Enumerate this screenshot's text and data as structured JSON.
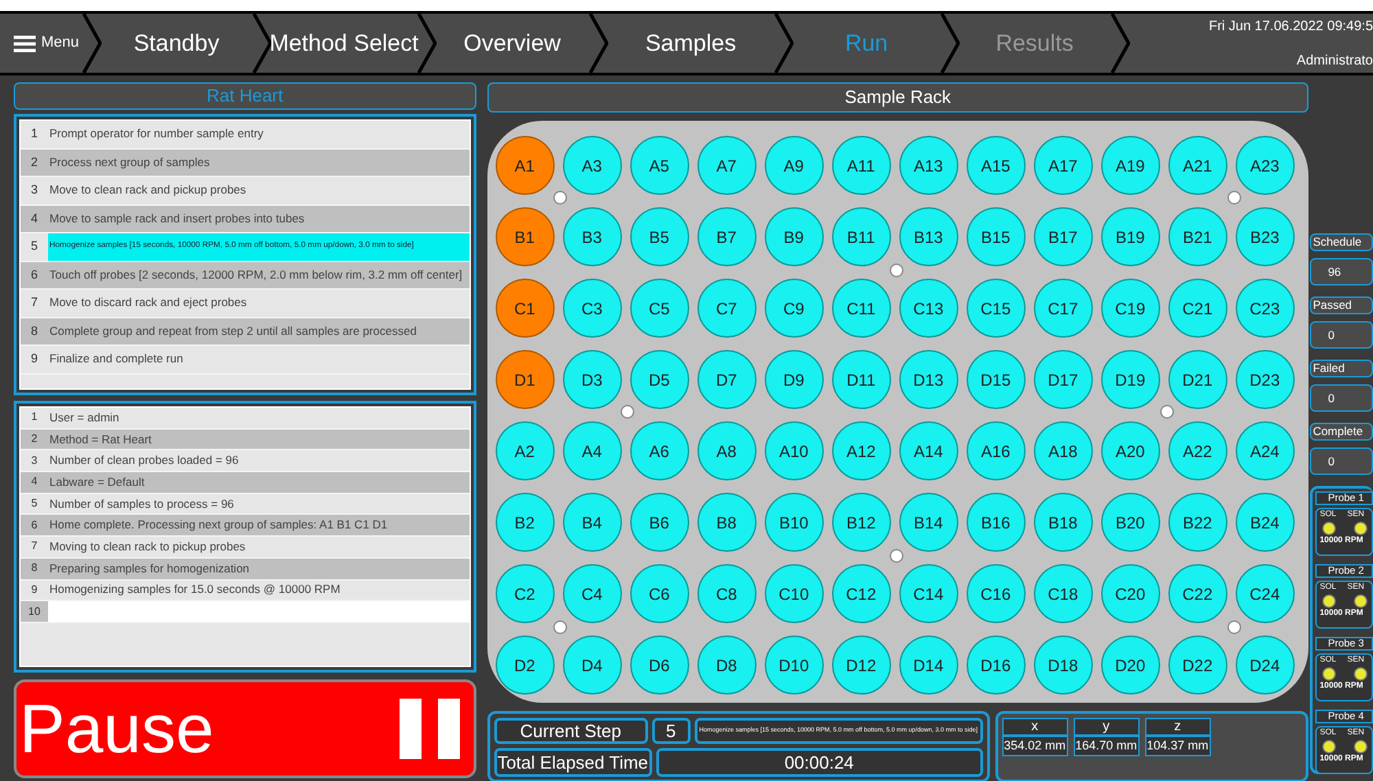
{
  "nav": {
    "menu_label": "Menu",
    "tabs": [
      {
        "label": "Standby",
        "selected": false,
        "disabled": false
      },
      {
        "label": "Method Select",
        "selected": false,
        "disabled": false
      },
      {
        "label": "Overview",
        "selected": false,
        "disabled": false
      },
      {
        "label": "Samples",
        "selected": false,
        "disabled": false
      },
      {
        "label": "Run",
        "selected": true,
        "disabled": false
      },
      {
        "label": "Results",
        "selected": false,
        "disabled": true
      }
    ],
    "datetime": "Fri Jun 17.06.2022 09:49:5",
    "user": "Administrato"
  },
  "method": {
    "title": "Rat Heart",
    "steps": [
      {
        "number": "1",
        "text": "Prompt operator for number sample entry",
        "selected": false
      },
      {
        "number": "2",
        "text": "Process next group of samples",
        "selected": false
      },
      {
        "number": "3",
        "text": "Move to clean rack and pickup probes",
        "selected": false
      },
      {
        "number": "4",
        "text": "Move to sample rack and insert probes into tubes",
        "selected": false
      },
      {
        "number": "5",
        "text": "Homogenize samples [15 seconds, 10000 RPM, 5.0 mm off bottom, 5.0 mm up/down, 3.0 mm to side]",
        "selected": true
      },
      {
        "number": "6",
        "text": "Touch off probes [2 seconds, 12000 RPM, 2.0 mm below rim, 3.2 mm off center]",
        "selected": false
      },
      {
        "number": "7",
        "text": "Move to discard rack and eject probes",
        "selected": false
      },
      {
        "number": "8",
        "text": "Complete group and repeat from step 2 until all samples are processed",
        "selected": false
      },
      {
        "number": "9",
        "text": "Finalize and complete run",
        "selected": false
      }
    ]
  },
  "log": [
    {
      "number": "1",
      "text": "User = admin",
      "current": false
    },
    {
      "number": "2",
      "text": "Method = Rat Heart",
      "current": false
    },
    {
      "number": "3",
      "text": "Number of clean probes loaded = 96",
      "current": false
    },
    {
      "number": "4",
      "text": "Labware = Default",
      "current": false
    },
    {
      "number": "5",
      "text": "Number of samples to process = 96",
      "current": false
    },
    {
      "number": "6",
      "text": "Home complete. Processing next group of samples: A1 B1 C1 D1",
      "current": false
    },
    {
      "number": "7",
      "text": "Moving to clean rack to pickup probes",
      "current": false
    },
    {
      "number": "8",
      "text": "Preparing samples for homogenization",
      "current": false
    },
    {
      "number": "9",
      "text": "Homogenizing samples for 15.0 seconds @ 10000 RPM",
      "current": false
    },
    {
      "number": "10",
      "current": true
    }
  ],
  "pause_button": {
    "label": "Pause"
  },
  "rack": {
    "title": "Sample Rack",
    "rows": [
      [
        {
          "label": "A1",
          "active": true
        },
        {
          "label": "A3",
          "active": false
        },
        {
          "label": "A5",
          "active": false
        },
        {
          "label": "A7",
          "active": false
        },
        {
          "label": "A9",
          "active": false
        },
        {
          "label": "A11",
          "active": false
        },
        {
          "label": "A13",
          "active": false
        },
        {
          "label": "A15",
          "active": false
        },
        {
          "label": "A17",
          "active": false
        },
        {
          "label": "A19",
          "active": false
        },
        {
          "label": "A21",
          "active": false
        },
        {
          "label": "A23",
          "active": false
        }
      ],
      [
        {
          "label": "B1",
          "active": true
        },
        {
          "label": "B3",
          "active": false
        },
        {
          "label": "B5",
          "active": false
        },
        {
          "label": "B7",
          "active": false
        },
        {
          "label": "B9",
          "active": false
        },
        {
          "label": "B11",
          "active": false
        },
        {
          "label": "B13",
          "active": false
        },
        {
          "label": "B15",
          "active": false
        },
        {
          "label": "B17",
          "active": false
        },
        {
          "label": "B19",
          "active": false
        },
        {
          "label": "B21",
          "active": false
        },
        {
          "label": "B23",
          "active": false
        }
      ],
      [
        {
          "label": "C1",
          "active": true
        },
        {
          "label": "C3",
          "active": false
        },
        {
          "label": "C5",
          "active": false
        },
        {
          "label": "C7",
          "active": false
        },
        {
          "label": "C9",
          "active": false
        },
        {
          "label": "C11",
          "active": false
        },
        {
          "label": "C13",
          "active": false
        },
        {
          "label": "C15",
          "active": false
        },
        {
          "label": "C17",
          "active": false
        },
        {
          "label": "C19",
          "active": false
        },
        {
          "label": "C21",
          "active": false
        },
        {
          "label": "C23",
          "active": false
        }
      ],
      [
        {
          "label": "D1",
          "active": true
        },
        {
          "label": "D3",
          "active": false
        },
        {
          "label": "D5",
          "active": false
        },
        {
          "label": "D7",
          "active": false
        },
        {
          "label": "D9",
          "active": false
        },
        {
          "label": "D11",
          "active": false
        },
        {
          "label": "D13",
          "active": false
        },
        {
          "label": "D15",
          "active": false
        },
        {
          "label": "D17",
          "active": false
        },
        {
          "label": "D19",
          "active": false
        },
        {
          "label": "D21",
          "active": false
        },
        {
          "label": "D23",
          "active": false
        }
      ],
      [
        {
          "label": "A2",
          "active": false
        },
        {
          "label": "A4",
          "active": false
        },
        {
          "label": "A6",
          "active": false
        },
        {
          "label": "A8",
          "active": false
        },
        {
          "label": "A10",
          "active": false
        },
        {
          "label": "A12",
          "active": false
        },
        {
          "label": "A14",
          "active": false
        },
        {
          "label": "A16",
          "active": false
        },
        {
          "label": "A18",
          "active": false
        },
        {
          "label": "A20",
          "active": false
        },
        {
          "label": "A22",
          "active": false
        },
        {
          "label": "A24",
          "active": false
        }
      ],
      [
        {
          "label": "B2",
          "active": false
        },
        {
          "label": "B4",
          "active": false
        },
        {
          "label": "B6",
          "active": false
        },
        {
          "label": "B8",
          "active": false
        },
        {
          "label": "B10",
          "active": false
        },
        {
          "label": "B12",
          "active": false
        },
        {
          "label": "B14",
          "active": false
        },
        {
          "label": "B16",
          "active": false
        },
        {
          "label": "B18",
          "active": false
        },
        {
          "label": "B20",
          "active": false
        },
        {
          "label": "B22",
          "active": false
        },
        {
          "label": "B24",
          "active": false
        }
      ],
      [
        {
          "label": "C2",
          "active": false
        },
        {
          "label": "C4",
          "active": false
        },
        {
          "label": "C6",
          "active": false
        },
        {
          "label": "C8",
          "active": false
        },
        {
          "label": "C10",
          "active": false
        },
        {
          "label": "C12",
          "active": false
        },
        {
          "label": "C14",
          "active": false
        },
        {
          "label": "C16",
          "active": false
        },
        {
          "label": "C18",
          "active": false
        },
        {
          "label": "C20",
          "active": false
        },
        {
          "label": "C22",
          "active": false
        },
        {
          "label": "C24",
          "active": false
        }
      ],
      [
        {
          "label": "D2",
          "active": false
        },
        {
          "label": "D4",
          "active": false
        },
        {
          "label": "D6",
          "active": false
        },
        {
          "label": "D8",
          "active": false
        },
        {
          "label": "D10",
          "active": false
        },
        {
          "label": "D12",
          "active": false
        },
        {
          "label": "D14",
          "active": false
        },
        {
          "label": "D16",
          "active": false
        },
        {
          "label": "D18",
          "active": false
        },
        {
          "label": "D20",
          "active": false
        },
        {
          "label": "D22",
          "active": false
        },
        {
          "label": "D24",
          "active": false
        }
      ]
    ]
  },
  "status": {
    "current_step_label": "Current Step",
    "current_step": "5",
    "current_step_text": "Homogenize samples [15 seconds, 10000 RPM, 5.0 mm off bottom, 5.0 mm up/down, 3.0 mm to side]",
    "elapsed_label": "Total Elapsed Time",
    "elapsed": "00:00:24"
  },
  "position": [
    {
      "axis": "x",
      "value": "354.02 mm"
    },
    {
      "axis": "y",
      "value": "164.70 mm"
    },
    {
      "axis": "z",
      "value": "104.37 mm"
    }
  ],
  "counters": [
    {
      "label": "Schedule",
      "value": "96"
    },
    {
      "label": "Passed",
      "value": "0"
    },
    {
      "label": "Failed",
      "value": "0"
    },
    {
      "label": "Complete",
      "value": "0"
    }
  ],
  "probes": [
    {
      "title": "Probe 1",
      "sol": "SOL",
      "sen": "SEN",
      "rpm": "10000 RPM"
    },
    {
      "title": "Probe 2",
      "sol": "SOL",
      "sen": "SEN",
      "rpm": "10000 RPM"
    },
    {
      "title": "Probe 3",
      "sol": "SOL",
      "sen": "SEN",
      "rpm": "10000 RPM"
    },
    {
      "title": "Probe 4",
      "sol": "SOL",
      "sen": "SEN",
      "rpm": "10000 RPM"
    }
  ]
}
